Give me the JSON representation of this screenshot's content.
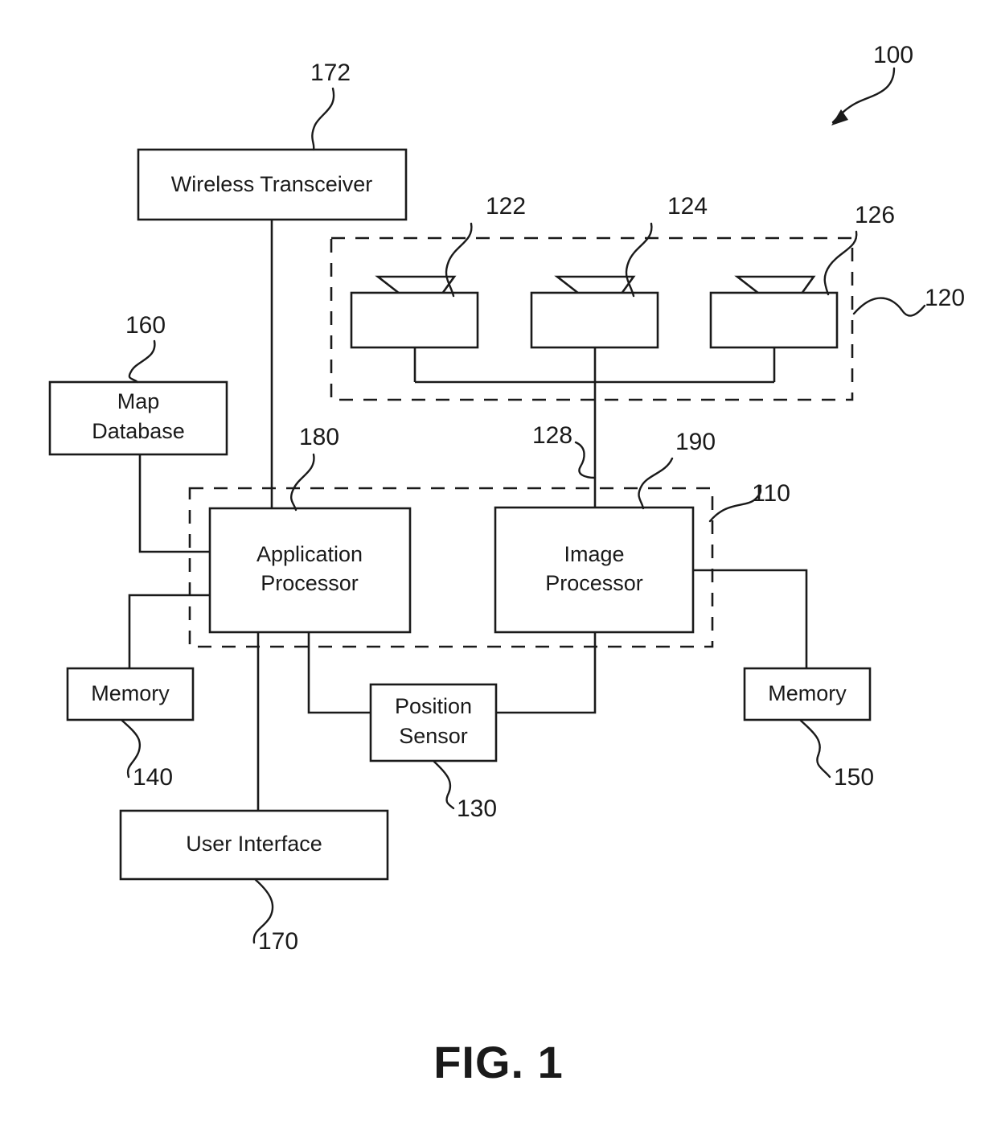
{
  "figure": {
    "caption": "FIG. 1",
    "system_ref": "100"
  },
  "blocks": [
    {
      "id": "wireless-transceiver",
      "label_line1": "Wireless Transceiver",
      "label_line2": "",
      "ref": "172"
    },
    {
      "id": "map-database",
      "label_line1": "Map",
      "label_line2": "Database",
      "ref": "160"
    },
    {
      "id": "application-processor",
      "label_line1": "Application",
      "label_line2": "Processor",
      "ref": "180"
    },
    {
      "id": "image-processor",
      "label_line1": "Image",
      "label_line2": "Processor",
      "ref": "190"
    },
    {
      "id": "memory-left",
      "label_line1": "Memory",
      "label_line2": "",
      "ref": "140"
    },
    {
      "id": "memory-right",
      "label_line1": "Memory",
      "label_line2": "",
      "ref": "150"
    },
    {
      "id": "position-sensor",
      "label_line1": "Position",
      "label_line2": "Sensor",
      "ref": "130"
    },
    {
      "id": "user-interface",
      "label_line1": "User Interface",
      "label_line2": "",
      "ref": "170"
    }
  ],
  "cameras": {
    "group_ref": "120",
    "bus_ref": "128",
    "units": [
      {
        "id": "image-capture-device-1",
        "ref": "122"
      },
      {
        "id": "image-capture-device-2",
        "ref": "124"
      },
      {
        "id": "image-capture-device-3",
        "ref": "126"
      }
    ]
  },
  "processing_unit": {
    "ref": "110"
  },
  "refs": {
    "r100": "100",
    "r110": "110",
    "r120": "120",
    "r122": "122",
    "r124": "124",
    "r126": "126",
    "r128": "128",
    "r130": "130",
    "r140": "140",
    "r150": "150",
    "r160": "160",
    "r170": "170",
    "r172": "172",
    "r180": "180",
    "r190": "190"
  },
  "labels": {
    "wireless_transceiver": "Wireless Transceiver",
    "map": "Map",
    "database": "Database",
    "application": "Application",
    "processor": "Processor",
    "image": "Image",
    "processor2": "Processor",
    "memory_left": "Memory",
    "memory_right": "Memory",
    "position": "Position",
    "sensor": "Sensor",
    "user_interface": "User Interface",
    "fig_caption": "FIG. 1"
  },
  "colors": {
    "ink": "#1a1a1a",
    "paper": "#ffffff"
  }
}
